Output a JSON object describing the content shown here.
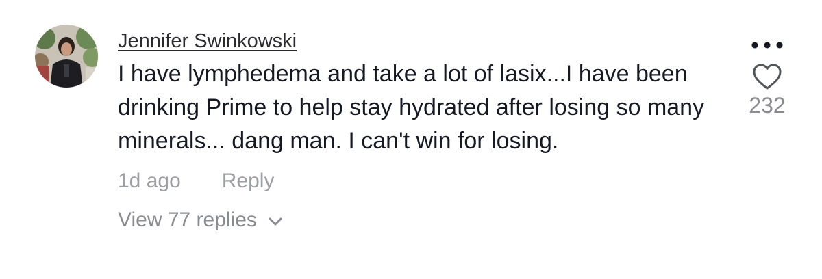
{
  "comment": {
    "author": "Jennifer Swinkowski",
    "text": "I have lymphedema and take a lot of lasix...I have been drinking Prime to help stay hydrated after losing so many minerals... dang man. I can't win for losing.",
    "timestamp": "1d ago",
    "reply_label": "Reply",
    "view_replies_label": "View 77 replies",
    "like_count": "232"
  },
  "icons": {
    "more": "more-options-icon",
    "like": "heart-outline-icon",
    "expand": "chevron-down-icon"
  },
  "colors": {
    "text": "#161823",
    "secondary": "#9d9ea3",
    "icon": "#545559"
  }
}
